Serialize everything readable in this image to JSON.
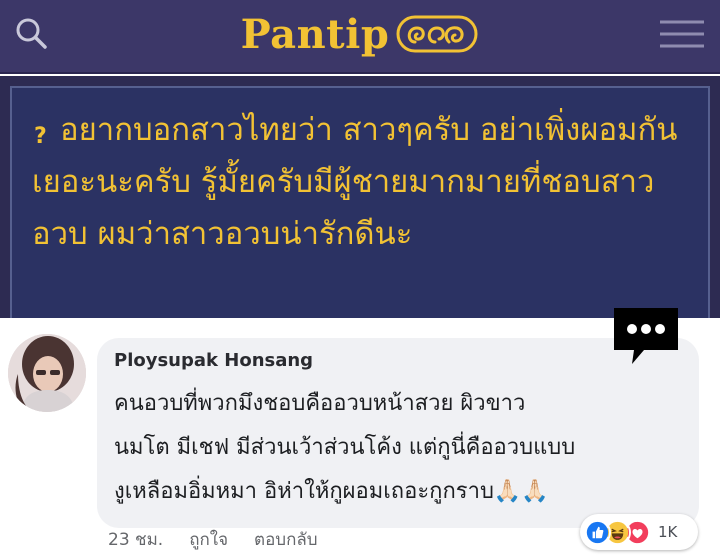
{
  "header": {
    "brand_text": "Pantip",
    "brand_color": "#f2c234",
    "background": "#3c3768",
    "search_icon": "search-icon",
    "menu_icon": "hamburger-menu-icon"
  },
  "topic": {
    "badge": "?",
    "title": "อยากบอกสาวไทยว่า สาวๆครับ อย่าเพิ่งผอมกันเยอะนะครับ รู้มั้ยครับมีผู้ชายมากมายที่ชอบสาวอวบ ผมว่าสาวอวบน่ารักดีนะ"
  },
  "comment": {
    "author": "Ploysupak Honsang",
    "lines": [
      "คนอวบที่พวกมึงชอบคืออวบหน้าสวย ผิวขาว",
      "นมโต มีเชฟ มีส่วนเว้าส่วนโค้ง แต่กูนี่คืออวบแบบ",
      "งูเหลือมอิ่มหมา อิห่าให้กูผอมเถอะกูกราบ"
    ],
    "emoji": "🙏🏻🙏🏻",
    "timestamp": "23 ชม.",
    "like_label": "ถูกใจ",
    "reply_label": "ตอบกลับ",
    "reactions": [
      "like",
      "haha",
      "love"
    ],
    "reaction_count": "1K"
  }
}
